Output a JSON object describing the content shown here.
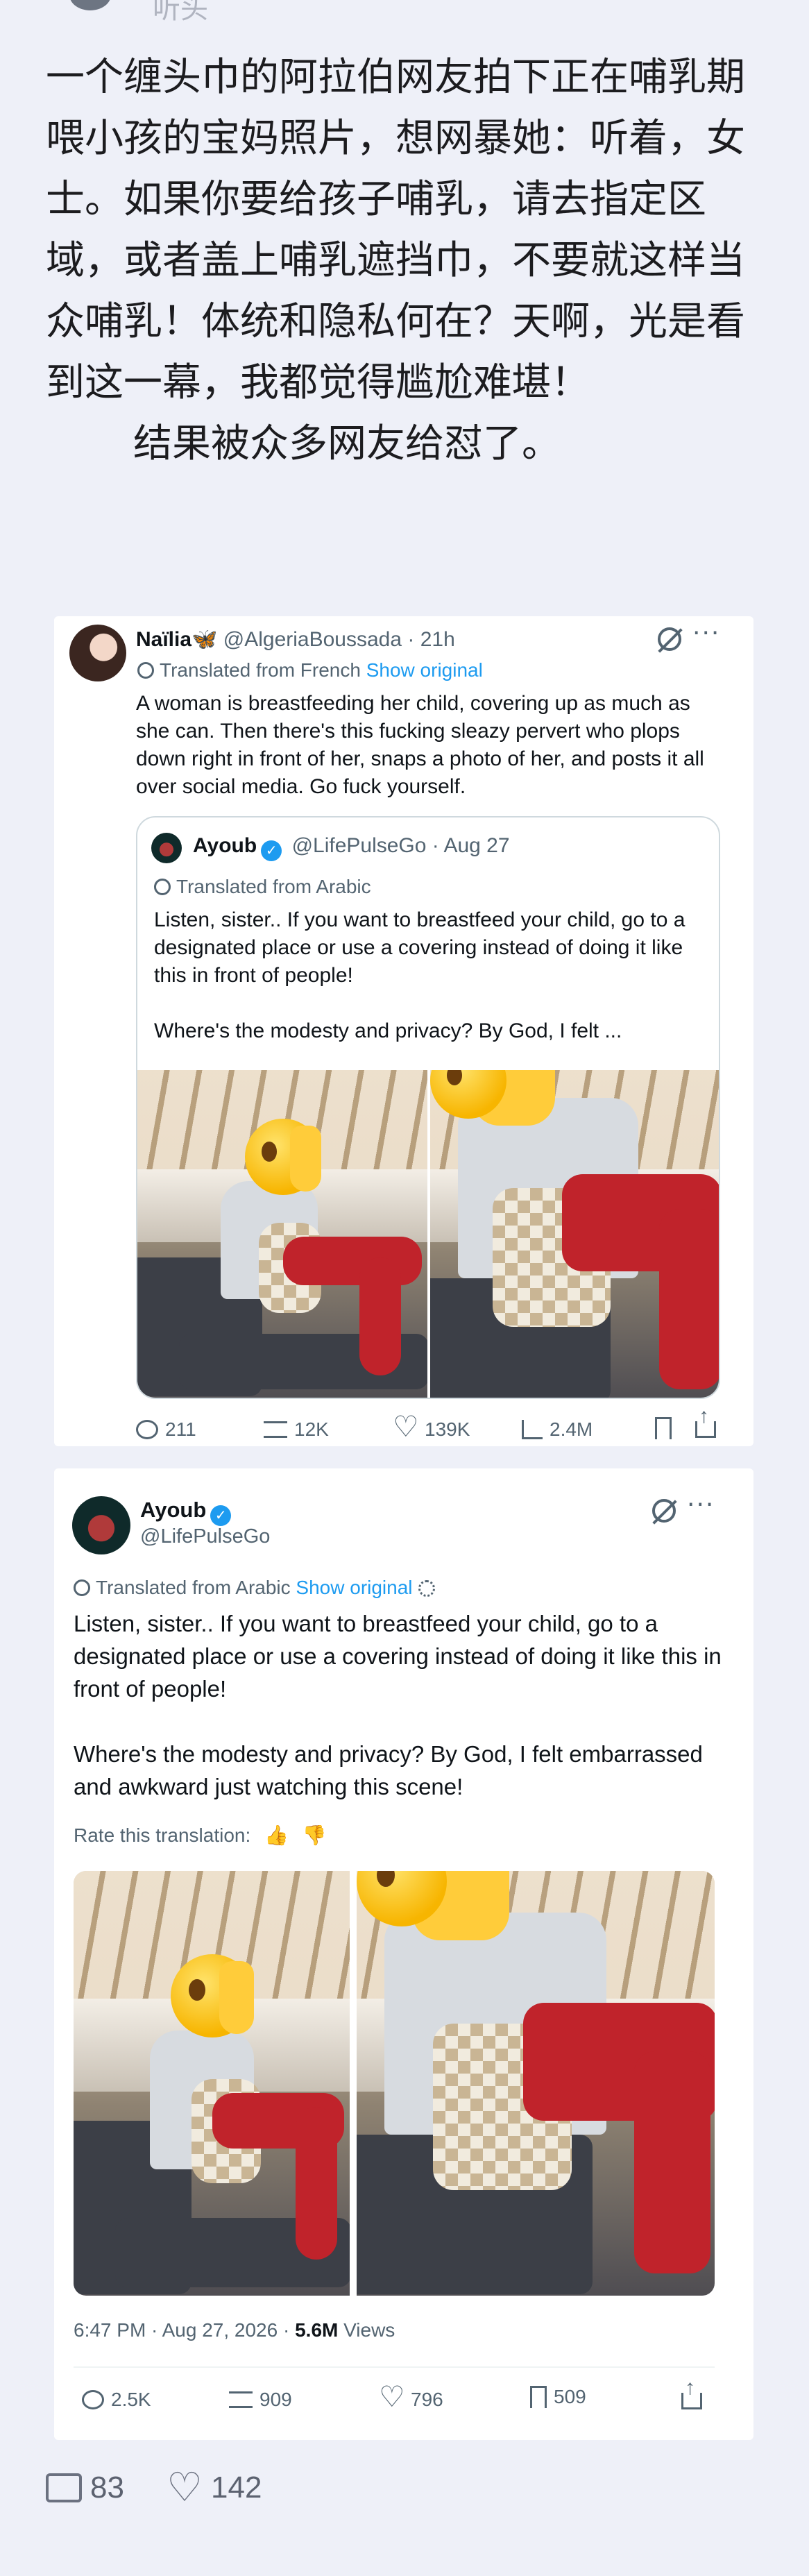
{
  "article": {
    "paragraph1": "一个缠头巾的阿拉伯网友拍下正在哺乳期喂小孩的宝妈照片，想网暴她：听着，女士。如果你要给孩子哺乳，请去指定区域，或者盖上哺乳遮挡巾，不要就这样当众哺乳！体统和隐私何在？天啊，光是看到这一幕，我都觉得尴尬难堪！",
    "paragraph2": "结果被众多网友给怼了。"
  },
  "quote_tweet": {
    "name": "Naïlia🦋",
    "handle": "@AlgeriaBoussada",
    "time": "· 21h",
    "translated_label": "Translated from French",
    "show_original": "Show original",
    "text": "A woman is breastfeeding her child, covering up as much as she can. Then there's this fucking sleazy pervert who plops down right in front of her, snaps a photo of her, and posts it all over social media. Go fuck yourself.",
    "quoted": {
      "name": "Ayoub",
      "handle": "@LifePulseGo",
      "date": "· Aug 27",
      "translated_label": "Translated from Arabic",
      "text": "Listen, sister.. If you want to breastfeed your child, go to a designated place or use a covering instead of doing it like this in front of people!\n\nWhere's the modesty and privacy? By God, I felt ..."
    },
    "stats": {
      "replies": "211",
      "reposts": "12K",
      "likes": "139K",
      "views": "2.4M"
    }
  },
  "main_tweet": {
    "name": "Ayoub",
    "handle": "@LifePulseGo",
    "translated_label": "Translated from Arabic",
    "show_original": "Show original",
    "text": "Listen, sister.. If you want to breastfeed your child, go to a designated place or use a covering instead of doing it like this in front of people!\n\nWhere's the modesty and privacy? By God, I felt embarrassed and awkward just watching this scene!",
    "rate_label": "Rate this translation:",
    "timestamp": "6:47 PM · Aug 27, 2026 · ",
    "views_count": "5.6M",
    "views_label": " Views",
    "stats": {
      "replies": "2.5K",
      "reposts": "909",
      "likes": "796",
      "bookmarks": "509"
    }
  },
  "footer": {
    "comments": "83",
    "likes": "142"
  },
  "colors": {
    "accent": "#1d9bf0",
    "background": "#eef0f8",
    "text_secondary": "#536471"
  },
  "top_stub_text": "听头"
}
